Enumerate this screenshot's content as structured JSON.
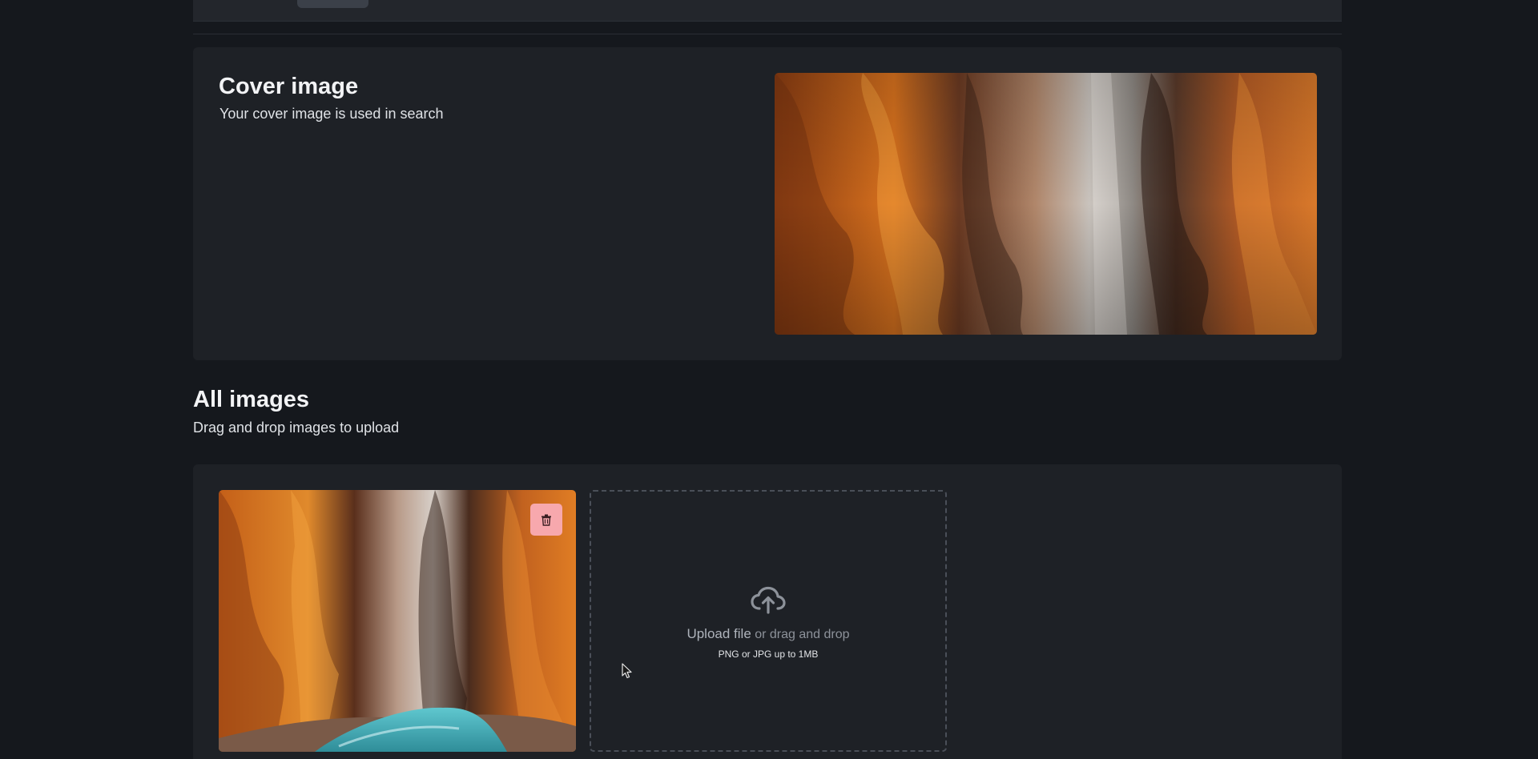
{
  "cover": {
    "title": "Cover image",
    "subtitle": "Your cover image is used in search",
    "image": "canyon-photo"
  },
  "gallery": {
    "title": "All images",
    "subtitle": "Drag and drop images to upload",
    "images": [
      {
        "image": "canyon-photo-with-river",
        "delete_icon": "trash-icon"
      }
    ],
    "upload": {
      "link": "Upload file",
      "rest": " or drag and drop",
      "hint": "PNG or JPG up to 1MB",
      "icon": "cloud-upload-icon"
    }
  },
  "colors": {
    "background": "#15181d",
    "card": "#1e2126",
    "delete_button": "#f7a8ad"
  }
}
